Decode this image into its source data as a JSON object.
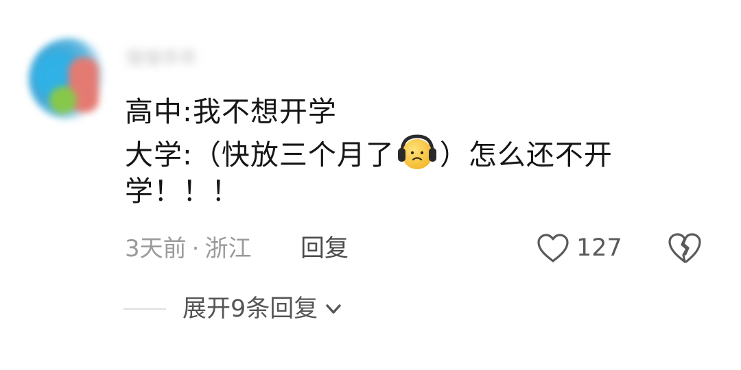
{
  "comment": {
    "username": "慢慢乖乖",
    "lines": [
      "高中:我不想开学",
      [
        "大学:（快放三个月了",
        "）怎么还不开"
      ],
      "学！！！"
    ],
    "emoji_icon": "headphones-frown-face-icon",
    "time": "3天前",
    "separator": "·",
    "location": "浙江",
    "reply_label": "回复",
    "like_count": "127",
    "expand_label": "展开9条回复"
  },
  "colors": {
    "text": "#161616",
    "meta": "#9a9a9a",
    "action": "#555555",
    "emoji_yellow": "#f7c338"
  }
}
